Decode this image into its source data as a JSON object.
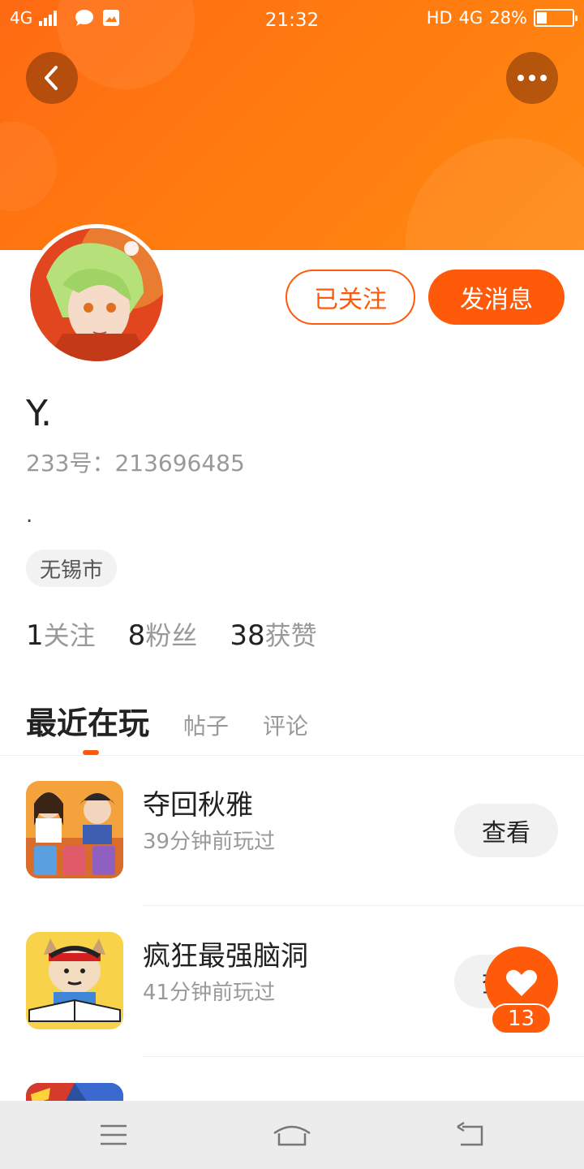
{
  "status_bar": {
    "network_left": "4G",
    "time": "21:32",
    "hd": "HD",
    "network_right": "4G",
    "battery": "28%",
    "battery_level": 0.28
  },
  "header": {
    "back_icon": "chevron-left-icon",
    "more_icon": "more-dots-icon",
    "accent_color": "#ff5a0a"
  },
  "profile": {
    "followed_label": "已关注",
    "message_label": "发消息",
    "username": "Y.",
    "user_id": "233号：213696485",
    "bio": ".",
    "city": "无锡市",
    "stats": [
      {
        "num": "1",
        "label": "关注"
      },
      {
        "num": "8",
        "label": "粉丝"
      },
      {
        "num": "38",
        "label": "获赞"
      }
    ]
  },
  "tabs": [
    {
      "label": "最近在玩",
      "active": true
    },
    {
      "label": "帖子",
      "active": false
    },
    {
      "label": "评论",
      "active": false
    }
  ],
  "games": [
    {
      "name": "夺回秋雅",
      "time": "39分钟前玩过",
      "button": "查看"
    },
    {
      "name": "疯狂最强脑洞",
      "time": "41分钟前玩过",
      "button": "查看"
    }
  ],
  "like": {
    "icon": "heart-icon",
    "count": "13"
  },
  "navbar": {
    "menu_icon": "menu-icon",
    "home_icon": "home-icon",
    "back_icon": "back-arrow-icon"
  }
}
